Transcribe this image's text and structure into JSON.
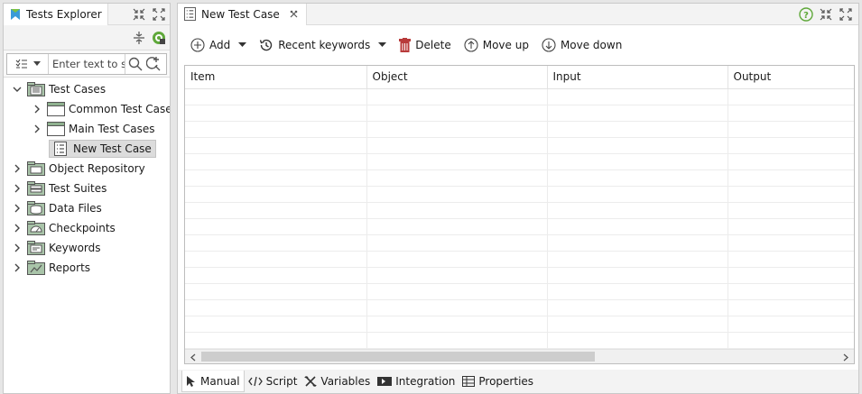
{
  "explorer": {
    "title": "Tests Explorer",
    "search_placeholder": "Enter text to search",
    "tree": [
      {
        "label": "Test Cases",
        "expanded": true,
        "level": 0
      },
      {
        "label": "Common Test Cases",
        "expanded": false,
        "level": 1
      },
      {
        "label": "Main Test Cases",
        "expanded": false,
        "level": 1
      },
      {
        "label": "New Test Case",
        "selected": true,
        "level": 1
      },
      {
        "label": "Object Repository",
        "level": 0
      },
      {
        "label": "Test Suites",
        "level": 0
      },
      {
        "label": "Data Files",
        "level": 0
      },
      {
        "label": "Checkpoints",
        "level": 0
      },
      {
        "label": "Keywords",
        "level": 0
      },
      {
        "label": "Reports",
        "level": 0
      }
    ]
  },
  "editor": {
    "tab_title": "New Test Case",
    "toolbar": {
      "add": "Add",
      "recent_keywords": "Recent keywords",
      "delete": "Delete",
      "move_up": "Move up",
      "move_down": "Move down"
    },
    "columns": [
      "Item",
      "Object",
      "Input",
      "Output"
    ],
    "bottom_tabs": [
      "Manual",
      "Script",
      "Variables",
      "Integration",
      "Properties"
    ]
  },
  "colors": {
    "accent_green": "#5fa83a",
    "delete_red": "#b83a3a",
    "folder_green": "#8fb18f"
  }
}
